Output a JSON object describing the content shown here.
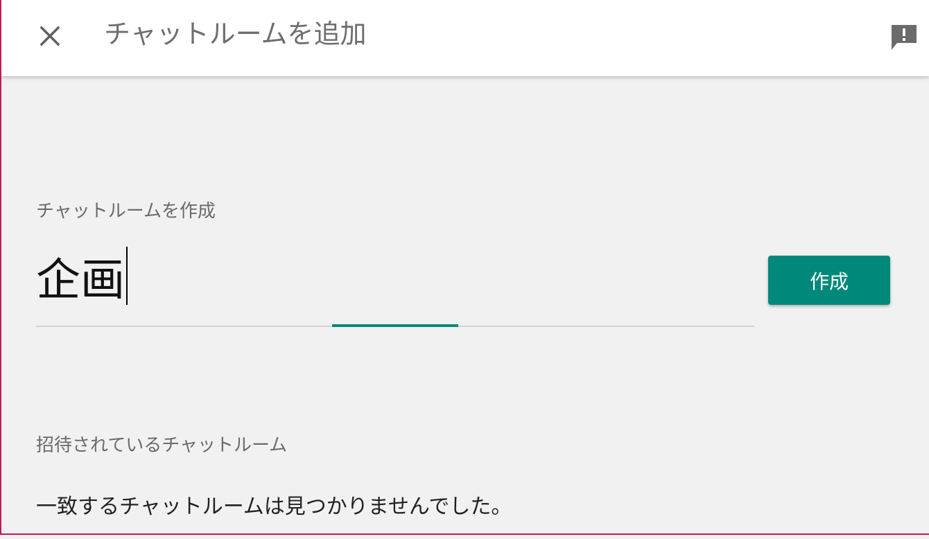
{
  "header": {
    "title": "チャットルームを追加",
    "close_icon": "close-icon",
    "feedback_icon": "feedback-icon"
  },
  "create_section": {
    "label": "チャットルームを作成",
    "input_value": "企画",
    "button_label": "作成"
  },
  "invited_section": {
    "label": "招待されているチャットルーム",
    "empty_message": "一致するチャットルームは見つかりませんでした。"
  },
  "colors": {
    "accent": "#00897b",
    "frame_border": "#c2185b",
    "background": "#f1f1f1",
    "header_bg": "#ffffff"
  }
}
